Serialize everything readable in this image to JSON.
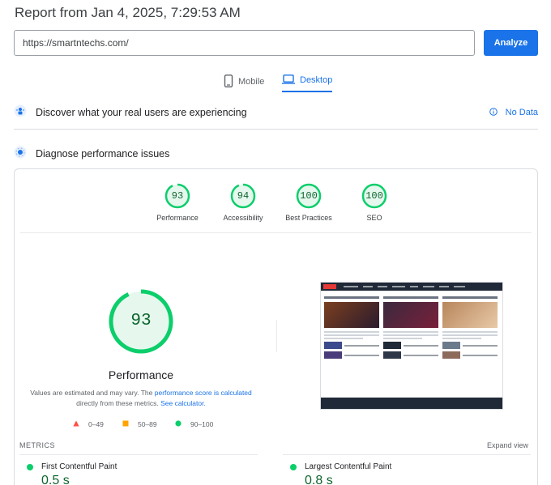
{
  "report": {
    "title": "Report from Jan 4, 2025, 7:29:53 AM"
  },
  "url_input": {
    "value": "https://smartntechs.com/"
  },
  "analyze_button": {
    "label": "Analyze"
  },
  "tabs": [
    {
      "label": "Mobile",
      "icon": "mobile-phone-icon",
      "selected": false
    },
    {
      "label": "Desktop",
      "icon": "laptop-icon",
      "selected": true
    }
  ],
  "discover": {
    "title": "Discover what your real users are experiencing",
    "status": "No Data",
    "status_icon": "info-icon"
  },
  "diagnose": {
    "title": "Diagnose performance issues"
  },
  "scores": [
    {
      "label": "Performance",
      "value": 93
    },
    {
      "label": "Accessibility",
      "value": 94
    },
    {
      "label": "Best Practices",
      "value": 100
    },
    {
      "label": "SEO",
      "value": 100
    }
  ],
  "performance": {
    "score": 93,
    "title": "Performance",
    "desc_prefix": "Values are estimated and may vary. The ",
    "desc_link1": "performance score is calculated",
    "desc_middle": " directly from these metrics. ",
    "desc_link2": "See calculator."
  },
  "legend": [
    {
      "range": "0–49",
      "color": "#ff4e42",
      "shape": "triangle"
    },
    {
      "range": "50–89",
      "color": "#ffa400",
      "shape": "square"
    },
    {
      "range": "90–100",
      "color": "#0cce6b",
      "shape": "circle"
    }
  ],
  "colors": {
    "accent": "#1a73e8",
    "good": "#0cce6b",
    "good_text": "#0d652d"
  },
  "metrics": {
    "heading": "METRICS",
    "expand_label": "Expand view",
    "items": [
      {
        "name": "First Contentful Paint",
        "value": "0.5 s"
      },
      {
        "name": "Largest Contentful Paint",
        "value": "0.8 s"
      }
    ]
  }
}
